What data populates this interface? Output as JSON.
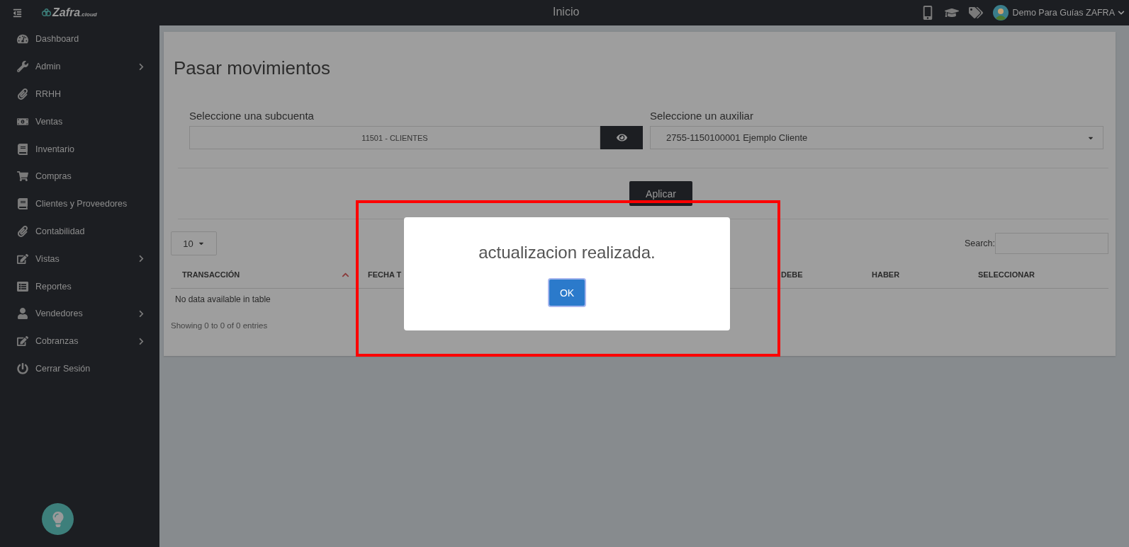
{
  "topbar": {
    "logo": {
      "name": "Zafra",
      "suffix": ".cloud"
    },
    "title": "Inicio",
    "user": "Demo Para Guías ZAFRA"
  },
  "sidebar": {
    "items": [
      {
        "label": "Dashboard",
        "expandable": false
      },
      {
        "label": "Admin",
        "expandable": true
      },
      {
        "label": "RRHH",
        "expandable": false
      },
      {
        "label": "Ventas",
        "expandable": false
      },
      {
        "label": "Inventario",
        "expandable": false
      },
      {
        "label": "Compras",
        "expandable": false
      },
      {
        "label": "Clientes y Proveedores",
        "expandable": false
      },
      {
        "label": "Contabilidad",
        "expandable": false
      },
      {
        "label": "Vistas",
        "expandable": true
      },
      {
        "label": "Reportes",
        "expandable": false
      },
      {
        "label": "Vendedores",
        "expandable": true
      },
      {
        "label": "Cobranzas",
        "expandable": true
      },
      {
        "label": "Cerrar Sesión",
        "expandable": false
      }
    ]
  },
  "page": {
    "title": "Pasar movimientos",
    "subcuenta": {
      "label": "Seleccione una subcuenta",
      "value": "11501 - CLIENTES"
    },
    "auxiliar": {
      "label": "Seleccione un auxiliar",
      "value": "2755-1150100001 Ejemplo Cliente"
    },
    "apply_button": "Aplicar",
    "page_length": "10",
    "search_label": "Search:",
    "table": {
      "columns": [
        {
          "label": "TRANSACCIÓN",
          "sorted": true
        },
        {
          "label": "FECHA T",
          "sorted": false
        },
        {
          "label": "DEBE",
          "sorted": false
        },
        {
          "label": "HABER",
          "sorted": false
        },
        {
          "label": "SELECCIONAR",
          "sorted": false
        }
      ],
      "empty_message": "No data available in table"
    },
    "info": "Showing 0 to 0 of 0 entries"
  },
  "dialog": {
    "message": "actualizacion realizada.",
    "button": "OK"
  },
  "annotation": {
    "kind": "highlight-frame"
  }
}
